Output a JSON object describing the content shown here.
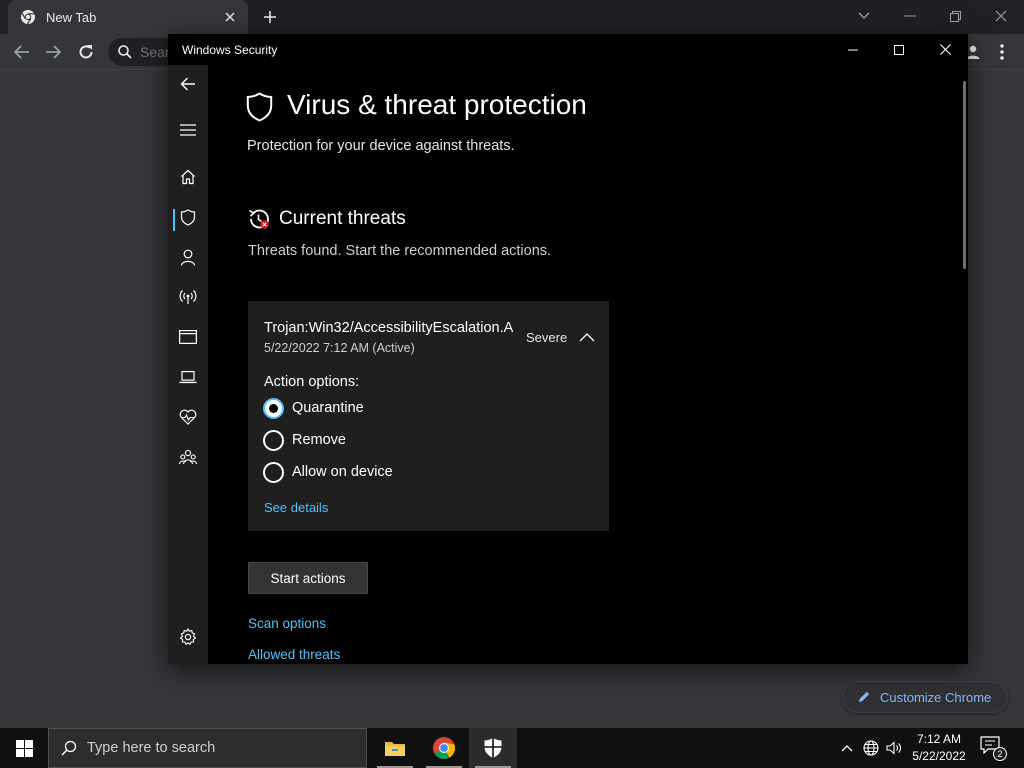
{
  "browser": {
    "tab_title": "New Tab",
    "omnibox_placeholder": "Search Google or type a URL",
    "omnibox_visible": "Sear",
    "customize_label": "Customize Chrome"
  },
  "window": {
    "title": "Windows Security"
  },
  "nav": {
    "items": [
      "back-icon",
      "menu-icon",
      "home-icon",
      "shield-icon",
      "account-icon",
      "network-icon",
      "app-browser-icon",
      "device-security-icon",
      "health-icon",
      "family-icon",
      "settings-icon"
    ],
    "active": "shield-icon"
  },
  "page": {
    "title": "Virus & threat protection",
    "subtitle": "Protection for your device against threats."
  },
  "threats": {
    "section_title": "Current threats",
    "section_desc": "Threats found. Start the recommended actions.",
    "threat": {
      "name": "Trojan:Win32/AccessibilityEscalation.A",
      "date": "5/22/2022 7:12 AM (Active)",
      "severity": "Severe",
      "action_label": "Action options:",
      "options": [
        "Quarantine",
        "Remove",
        "Allow on device"
      ],
      "selected_option": "Quarantine",
      "see_details": "See details"
    },
    "start_actions": "Start actions",
    "links": [
      "Scan options",
      "Allowed threats"
    ]
  },
  "taskbar": {
    "search_placeholder": "Type here to search",
    "time": "7:12 AM",
    "date": "5/22/2022",
    "notification_count": "2"
  },
  "colors": {
    "accent": "#4cc2ff",
    "window_bg": "#000000",
    "card_bg": "#1f1f1f",
    "chrome_bg": "#35363a"
  }
}
